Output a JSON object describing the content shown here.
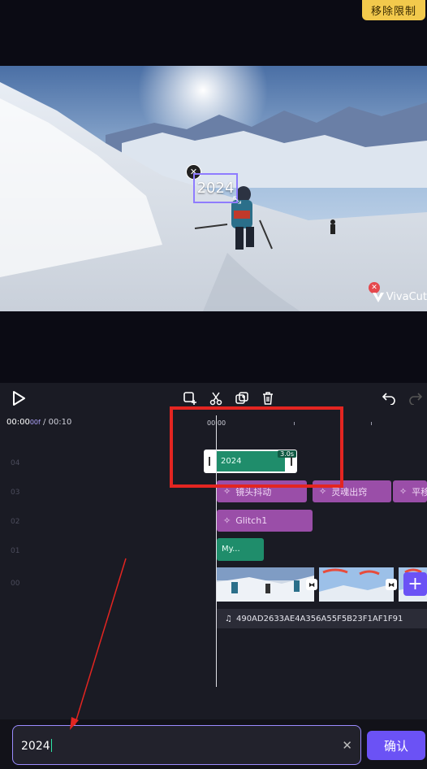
{
  "top": {
    "remove_limit_label": "移除限制"
  },
  "preview": {
    "text_overlay": "2024",
    "watermark_label": "VivaCut"
  },
  "toolbar": {
    "icons": [
      "play-icon",
      "add-keyframe-icon",
      "split-icon",
      "duplicate-icon",
      "delete-icon",
      "undo-icon",
      "redo-icon"
    ]
  },
  "timeline": {
    "current_time": "00:00",
    "current_frames": "00f",
    "separator": "/",
    "total_time": "00:10",
    "ruler_label": "00:00",
    "track_numbers": [
      "04",
      "03",
      "02",
      "01",
      "00"
    ],
    "text_clip": {
      "label": "2024",
      "duration": "3.0s"
    },
    "effects_row": [
      "镜头抖动",
      "灵魂出窍",
      "平移"
    ],
    "effect_clip": "Glitch1",
    "music_clip": "My...",
    "audio_label": "490AD2633AE4A356A55F5B23F1AF1F91"
  },
  "input": {
    "value": "2024",
    "confirm_label": "确认"
  },
  "colors": {
    "accent": "#6b52f5",
    "highlight": "#e32521",
    "effect": "#9a4ea8",
    "text_clip": "#1f8d6b",
    "badge": "#f2c94c"
  }
}
